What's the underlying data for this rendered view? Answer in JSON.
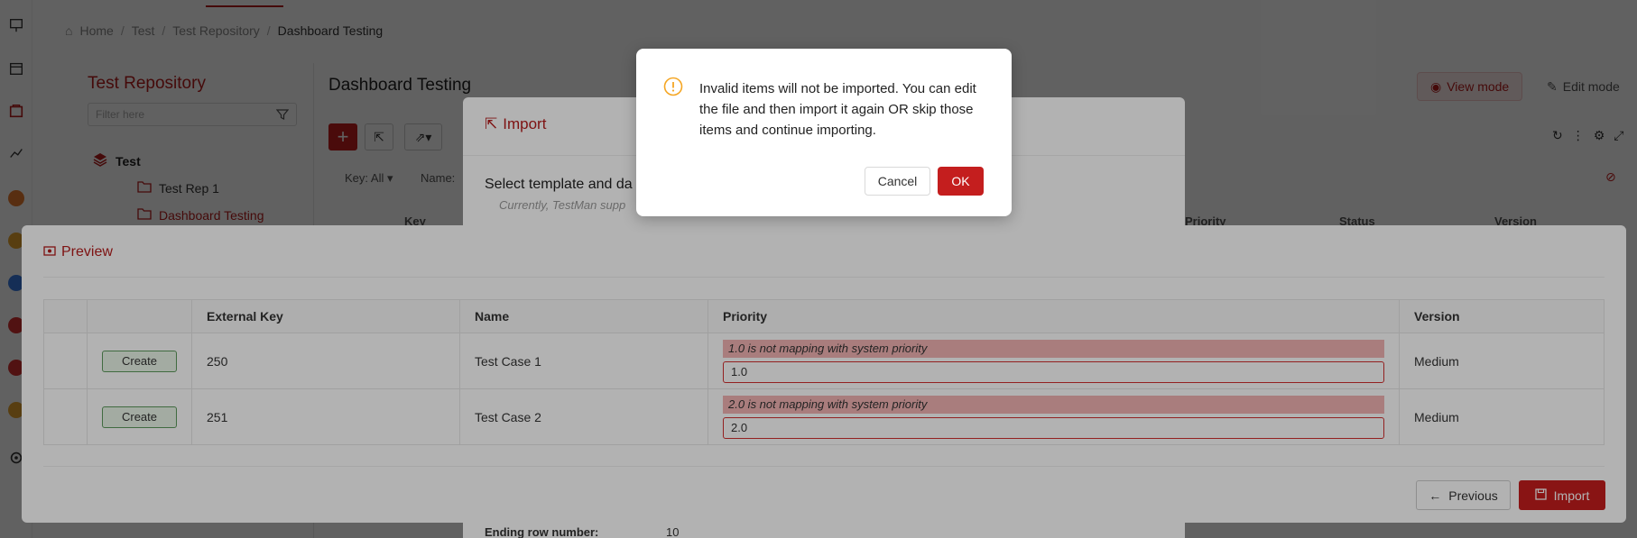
{
  "breadcrumb": [
    "Home",
    "Test",
    "Test Repository",
    "Dashboard Testing"
  ],
  "repo_panel": {
    "title": "Test Repository",
    "filter_placeholder": "Filter here",
    "root": "Test",
    "items": [
      "Test Rep 1",
      "Dashboard Testing"
    ]
  },
  "main": {
    "title": "Dashboard Testing",
    "view_mode": "View mode",
    "edit_mode": "Edit mode",
    "key_filter": "Key: All",
    "name_filter": "Name:",
    "columns": [
      "Key",
      "Priority",
      "Status",
      "Version"
    ]
  },
  "import_modal": {
    "title": "Import",
    "select_text": "Select template and da",
    "hint": "Currently, TestMan supp",
    "ending_row_label": "Ending row number:",
    "ending_row_value": "10"
  },
  "preview": {
    "title": "Preview",
    "headers": [
      "",
      "",
      "External Key",
      "Name",
      "Priority",
      "Version"
    ],
    "rows": [
      {
        "action": "Create",
        "external_key": "250",
        "name": "Test Case 1",
        "priority_error": "1.0 is not mapping with system priority",
        "priority_value": "1.0",
        "version": "Medium"
      },
      {
        "action": "Create",
        "external_key": "251",
        "name": "Test Case 2",
        "priority_error": "2.0 is not mapping with system priority",
        "priority_value": "2.0",
        "version": "Medium"
      }
    ],
    "previous_label": "Previous",
    "import_label": "Import"
  },
  "confirm": {
    "message": "Invalid items will not be imported. You can edit the file and then import it again OR skip those items and continue importing.",
    "cancel_label": "Cancel",
    "ok_label": "OK"
  },
  "colors": {
    "accent": "#c41e1e",
    "warning": "#f5a623",
    "error_bg": "#f3b4b4"
  }
}
